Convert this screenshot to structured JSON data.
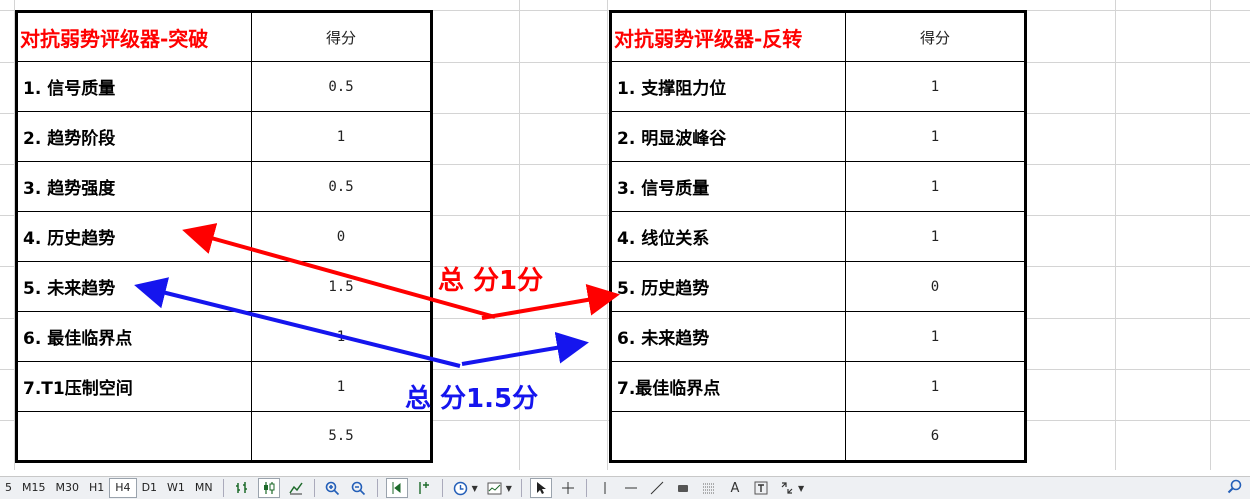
{
  "left_table": {
    "title": "对抗弱势评级器-突破",
    "score_header": "得分",
    "rows": [
      {
        "label": "1. 信号质量",
        "score": "0.5"
      },
      {
        "label": "2. 趋势阶段",
        "score": "1"
      },
      {
        "label": "3. 趋势强度",
        "score": "0.5"
      },
      {
        "label": "4. 历史趋势",
        "score": "0"
      },
      {
        "label": "5. 未来趋势",
        "score": "1.5"
      },
      {
        "label": "6. 最佳临界点",
        "score": "1"
      },
      {
        "label": "7.T1压制空间",
        "score": "1"
      }
    ],
    "total": "5.5"
  },
  "right_table": {
    "title": "对抗弱势评级器-反转",
    "score_header": "得分",
    "rows": [
      {
        "label": "1. 支撑阻力位",
        "score": "1"
      },
      {
        "label": "2. 明显波峰谷",
        "score": "1"
      },
      {
        "label": "3. 信号质量",
        "score": "1"
      },
      {
        "label": "4. 线位关系",
        "score": "1"
      },
      {
        "label": "5. 历史趋势",
        "score": "0"
      },
      {
        "label": "6. 未来趋势",
        "score": "1"
      },
      {
        "label": "7.最佳临界点",
        "score": "1"
      }
    ],
    "total": "6"
  },
  "annotations": {
    "red_note": "总 分1分",
    "blue_note": "总 分1.5分",
    "red_color": "#ff0000",
    "blue_color": "#1515ee"
  },
  "toolbar": {
    "timeframes": [
      "5",
      "M15",
      "M30",
      "H1",
      "H4",
      "D1",
      "W1",
      "MN"
    ],
    "active_timeframe": "H4",
    "icons": [
      "bar-chart-icon",
      "candlestick-icon",
      "line-chart-icon",
      "zoom-in-icon",
      "zoom-out-icon",
      "autoscroll-icon",
      "chart-shift-icon",
      "clock-icon",
      "template-icon",
      "cursor-icon",
      "crosshair-icon",
      "vertical-line-icon",
      "horizontal-line-icon",
      "trendline-icon",
      "rectangle-icon",
      "fibonacci-icon",
      "text-icon",
      "text-label-icon",
      "arrows-icon",
      "search-icon"
    ],
    "text_tool_label": "A"
  }
}
